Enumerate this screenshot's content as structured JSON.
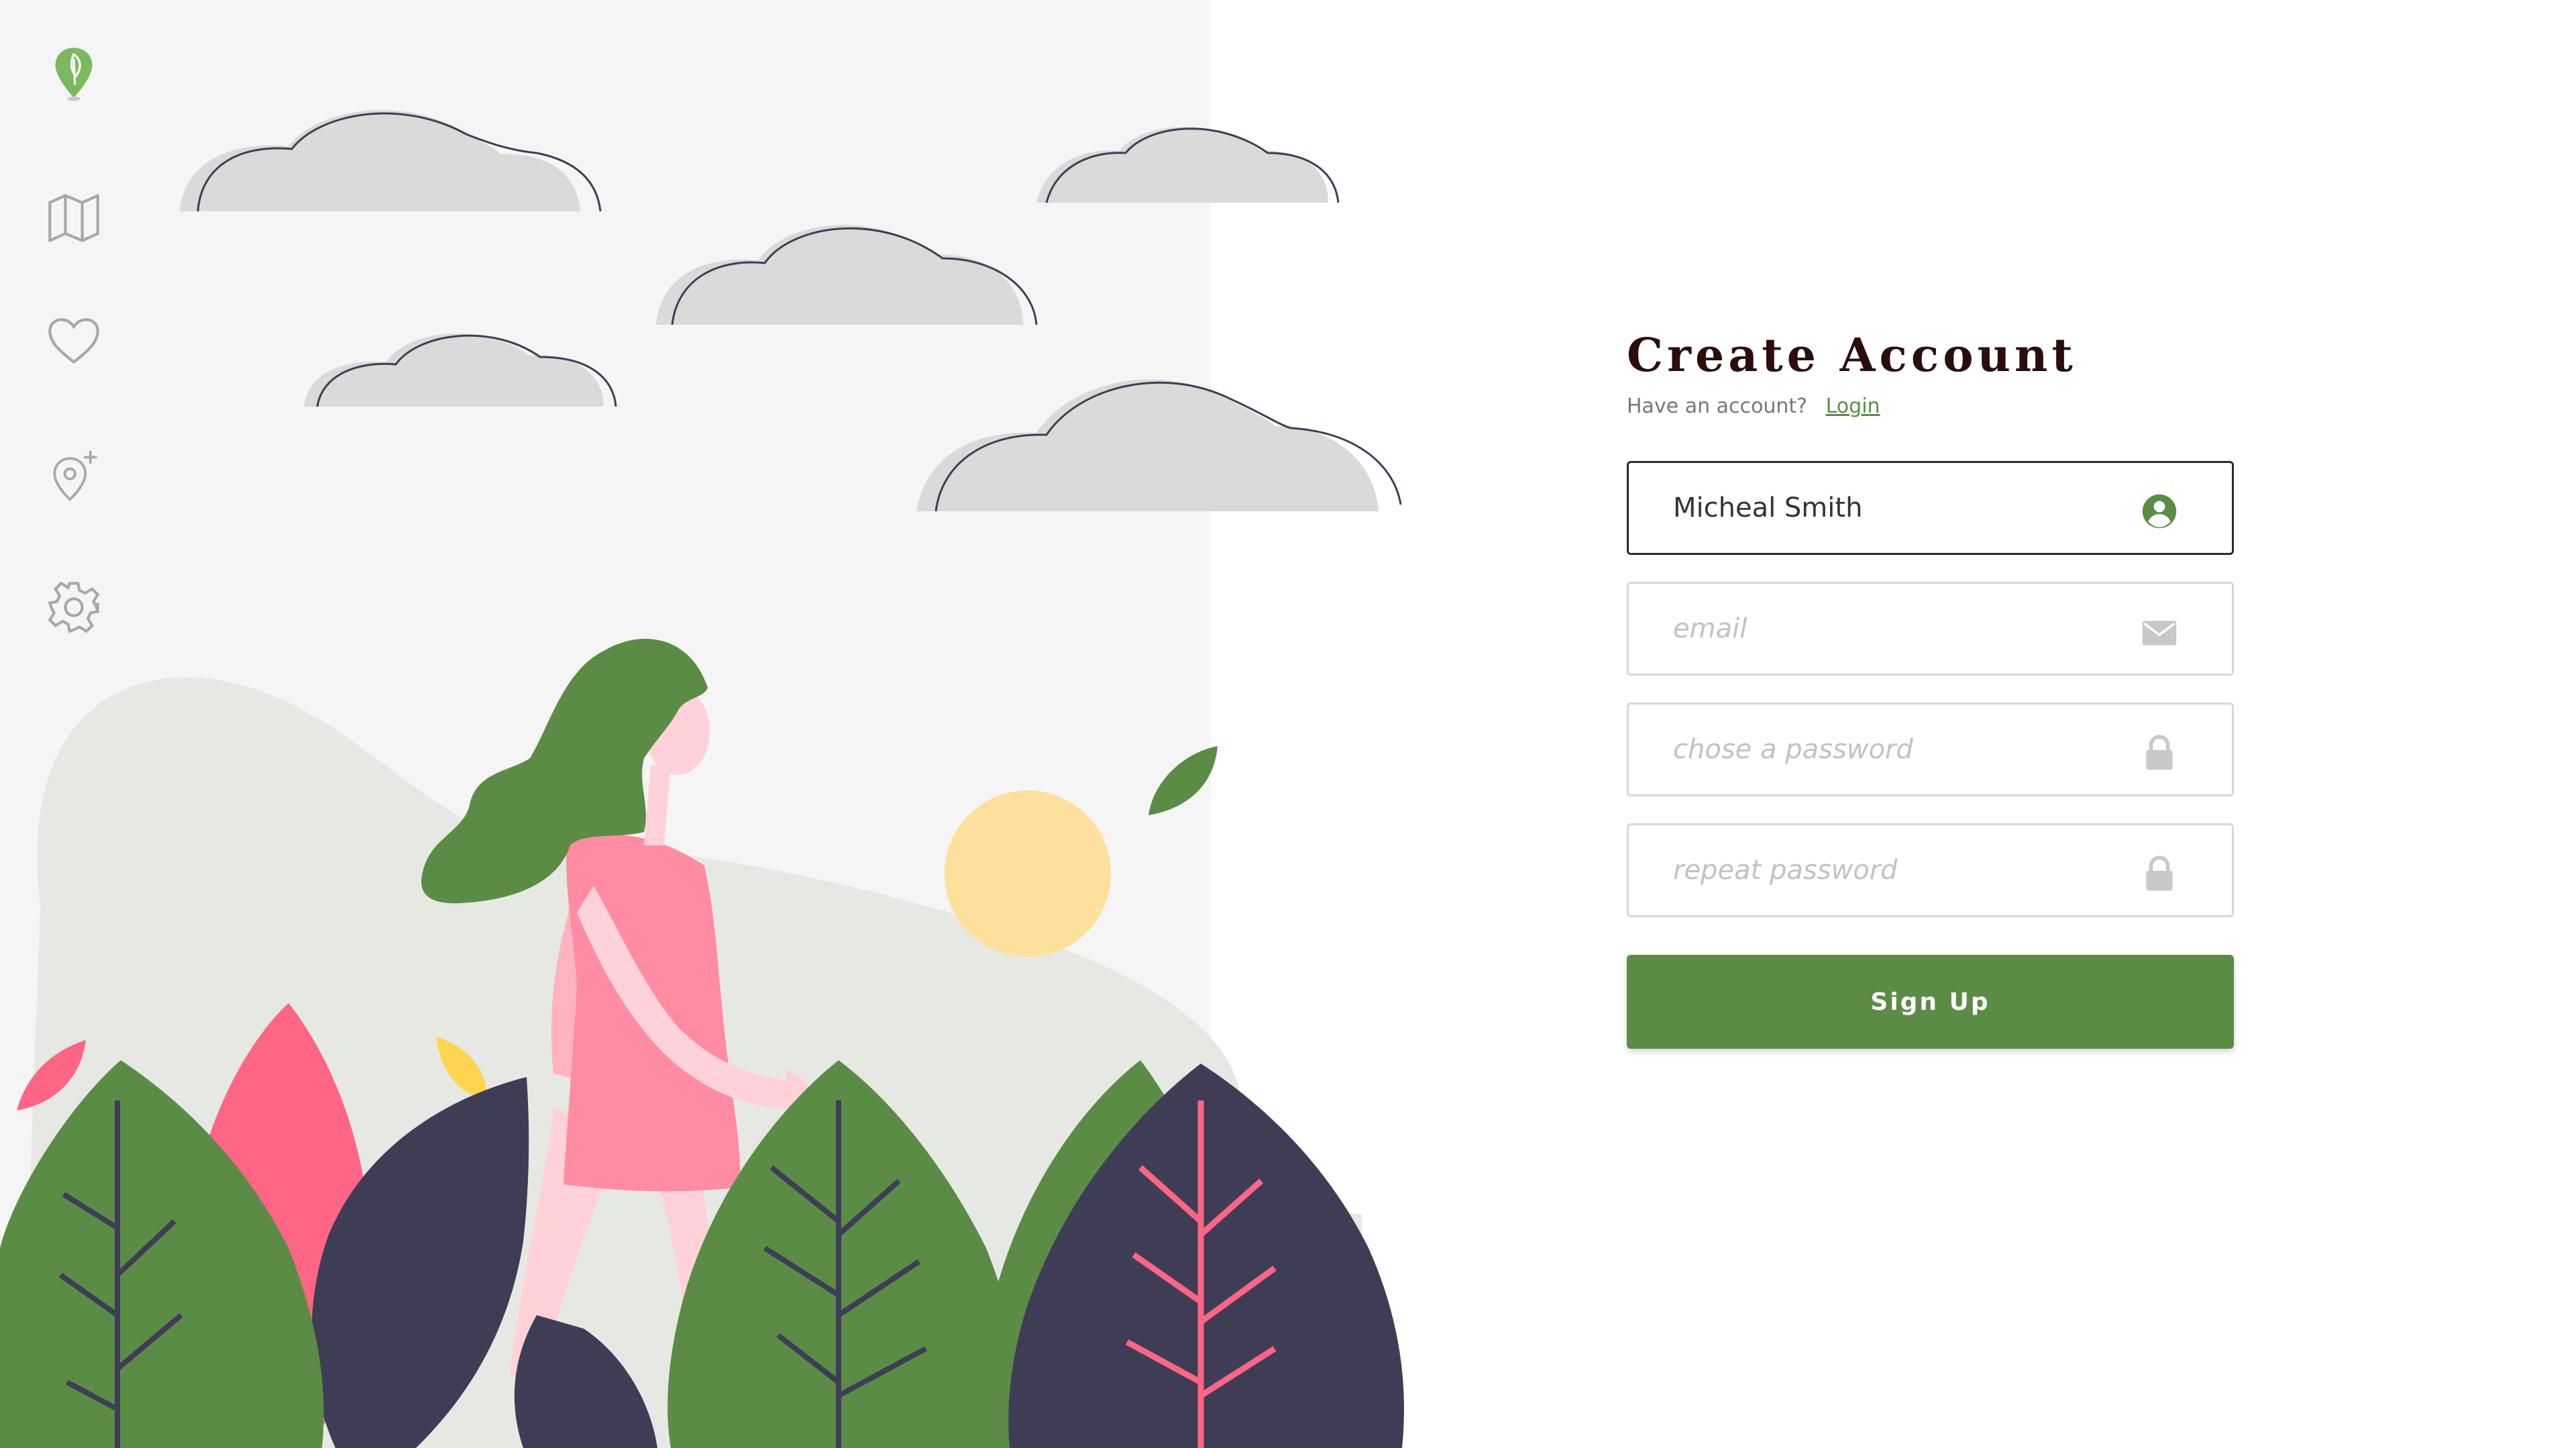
{
  "colors": {
    "brand": "#5b8c46",
    "title": "#2b0d0d",
    "left_panel_bg": "#f5f5f5",
    "page_bg": "#ffffff"
  },
  "sidebar": {
    "items": [
      {
        "name": "logo-leaf-pin-icon"
      },
      {
        "name": "map-icon"
      },
      {
        "name": "heart-icon"
      },
      {
        "name": "add-location-icon"
      },
      {
        "name": "gear-icon"
      }
    ]
  },
  "form": {
    "title": "Create Account",
    "subtitle": "Have an account?",
    "login_link": "Login",
    "fields": [
      {
        "value": "Micheal Smith",
        "placeholder": "",
        "icon": "user-circle-icon"
      },
      {
        "value": "",
        "placeholder": "email",
        "icon": "envelope-icon"
      },
      {
        "value": "",
        "placeholder": "chose a password",
        "icon": "lock-icon"
      },
      {
        "value": "",
        "placeholder": "repeat password",
        "icon": "lock-icon"
      }
    ],
    "submit_label": "Sign Up"
  }
}
